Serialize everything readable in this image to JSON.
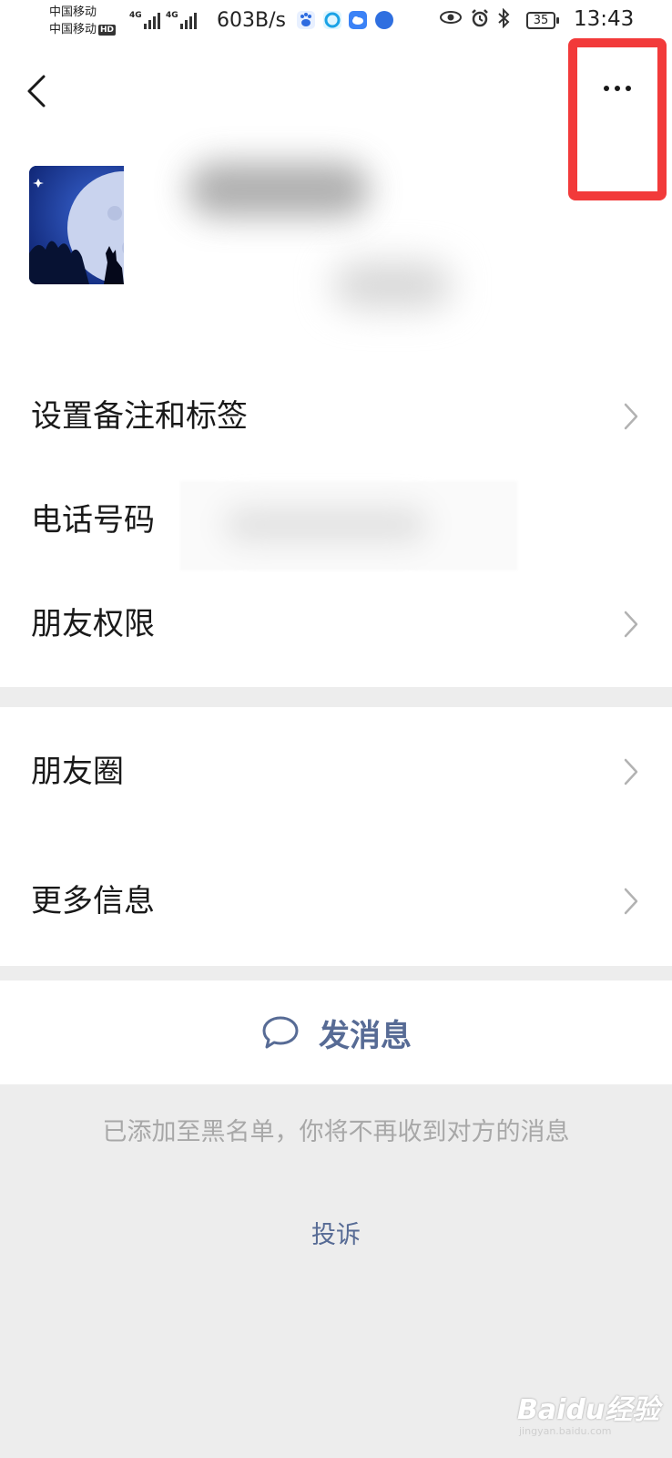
{
  "status_bar": {
    "carrier_1": "中国移动",
    "carrier_2": "中国移动",
    "hd_badge": "HD",
    "network_1": "4G",
    "network_2": "4G",
    "net_speed": "603B/s",
    "battery": "35",
    "time": "13:43"
  },
  "header": {
    "back_icon": "chevron-left-icon",
    "more_icon": "more-dots-icon"
  },
  "menu": {
    "items": [
      {
        "label": "设置备注和标签"
      },
      {
        "label": "电话号码"
      },
      {
        "label": "朋友权限"
      }
    ]
  },
  "section2": {
    "items": [
      {
        "label": "朋友圈"
      },
      {
        "label": "更多信息"
      }
    ]
  },
  "send_message": {
    "label": "发消息",
    "icon": "chat-bubble-icon"
  },
  "blacklist_notice": "已添加至黑名单，你将不再收到对方的消息",
  "complain_link": "投诉",
  "watermark": {
    "text": "Baidu经验",
    "sub": "jingyan.baidu.com"
  },
  "colors": {
    "link": "#576b95",
    "highlight": "#f23a3a",
    "background": "#ededed"
  }
}
